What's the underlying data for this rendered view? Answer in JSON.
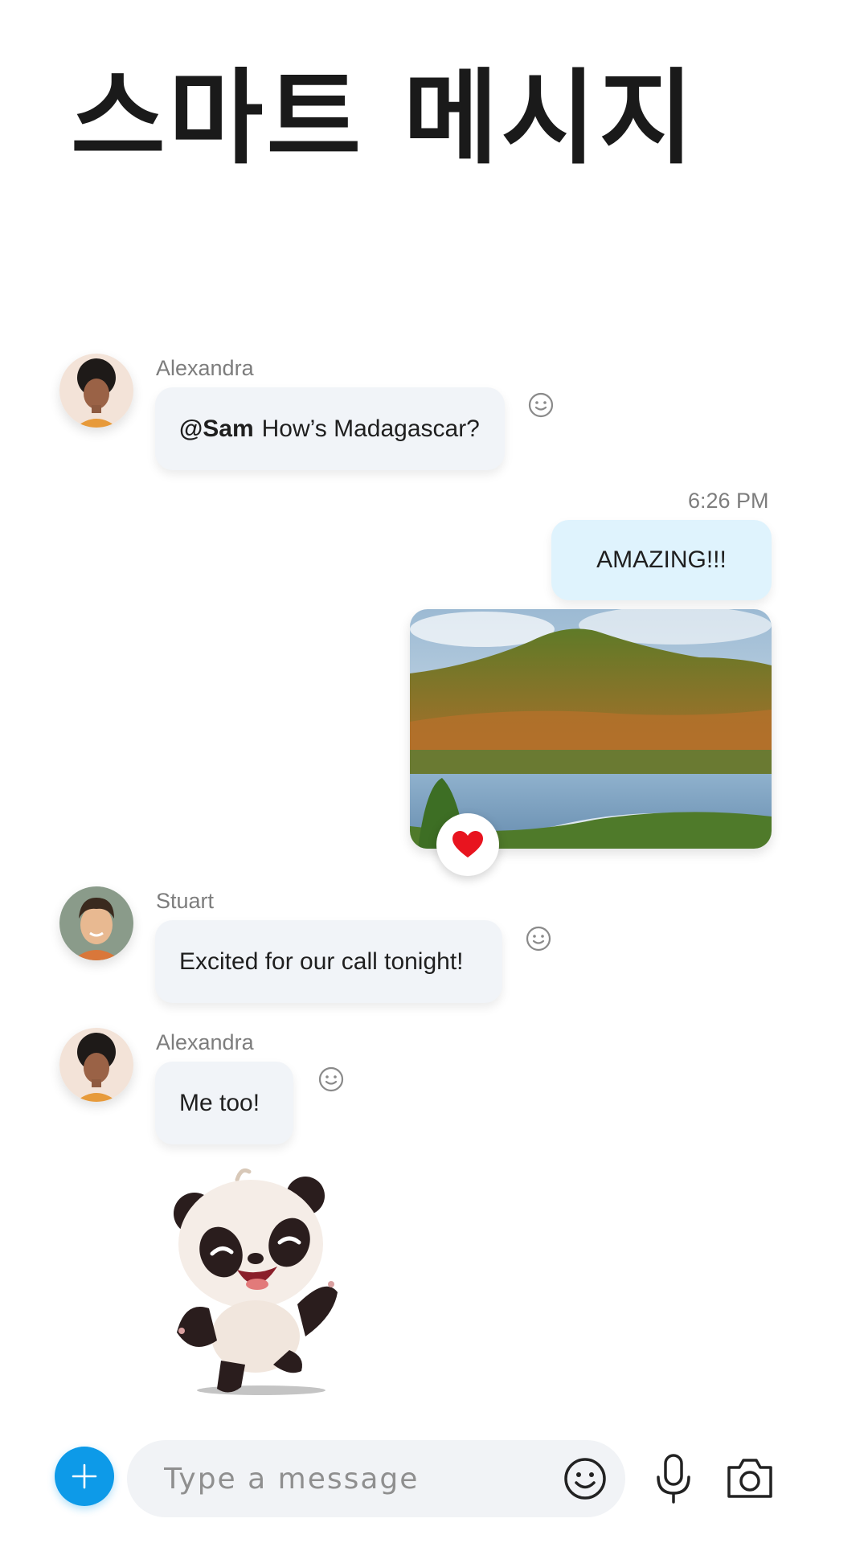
{
  "header": {
    "title": "스마트 메시지"
  },
  "messages": {
    "m1": {
      "sender": "Alexandra",
      "mention": "@Sam",
      "text": "How’s Madagascar?"
    },
    "m2": {
      "timestamp": "6:26 PM",
      "text": "AMAZING!!!"
    },
    "m3": {
      "sender": "Stuart",
      "text": "Excited for our call tonight!"
    },
    "m4": {
      "sender": "Alexandra",
      "text": "Me too!"
    }
  },
  "composer": {
    "placeholder": "Type a message"
  },
  "colors": {
    "accent": "#0d9ae8",
    "incoming_bubble": "#f1f4f8",
    "outgoing_bubble": "#dff3fd",
    "heart": "#e8141f"
  },
  "icons": {
    "reaction": "smiley-icon",
    "heart": "heart-icon",
    "add": "plus-icon",
    "emoji": "emoji-icon",
    "mic": "microphone-icon",
    "camera": "camera-icon"
  }
}
